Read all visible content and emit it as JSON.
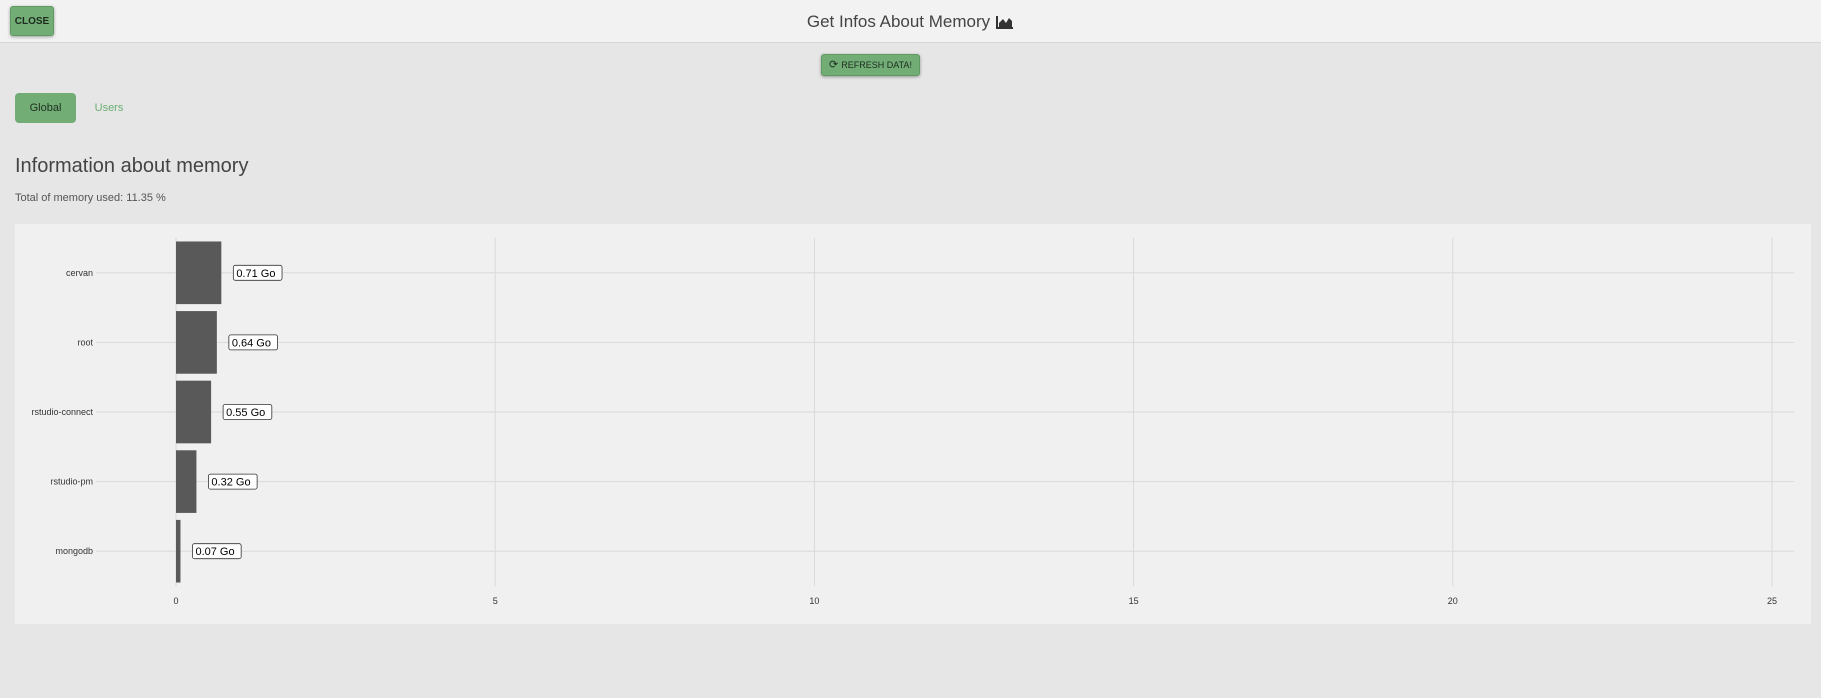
{
  "header": {
    "close_label": "CLOSE",
    "title": "Get Infos About Memory",
    "title_icon": "area-chart-icon"
  },
  "toolbar": {
    "refresh_label": "REFRESH DATA!",
    "refresh_icon": "refresh-icon"
  },
  "tabs": [
    {
      "label": "Global",
      "active": true
    },
    {
      "label": "Users",
      "active": false
    }
  ],
  "main": {
    "heading": "Information about memory",
    "total_text": "Total of memory used: 11.35 %"
  },
  "colors": {
    "accent": "#72ad76",
    "tab_inactive_text": "#6bae72",
    "bar": "#595959",
    "grid": "#d9d9d9"
  },
  "chart_data": {
    "type": "bar",
    "orientation": "horizontal",
    "categories": [
      "cervan",
      "root",
      "rstudio-connect",
      "rstudio-pm",
      "mongodb"
    ],
    "values": [
      0.71,
      0.64,
      0.55,
      0.32,
      0.07
    ],
    "data_labels": [
      "0.71 Go",
      "0.64 Go",
      "0.55 Go",
      "0.32 Go",
      "0.07 Go"
    ],
    "x_ticks": [
      0,
      5,
      10,
      15,
      20,
      25
    ],
    "xlim": [
      0,
      25
    ],
    "grid": true,
    "title": "",
    "xlabel": "",
    "ylabel": ""
  }
}
